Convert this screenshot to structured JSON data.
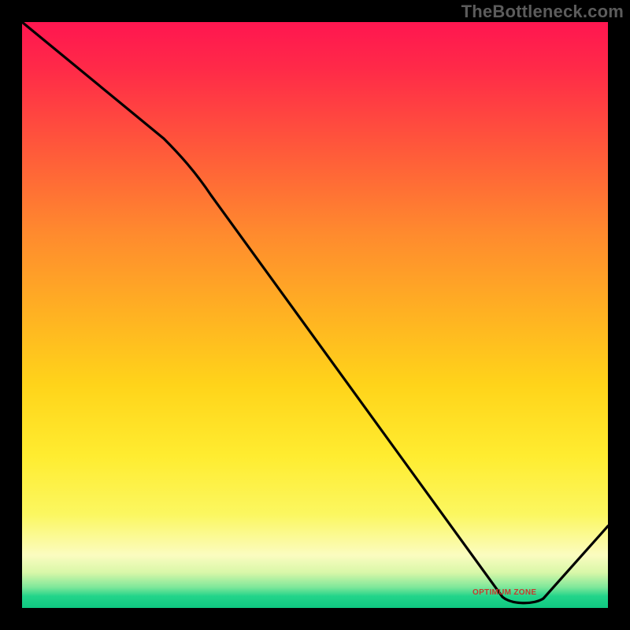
{
  "watermark": "TheBottleneck.com",
  "chart_data": {
    "type": "line",
    "title": "",
    "xlabel": "",
    "ylabel": "",
    "x": [
      0,
      24,
      82,
      88,
      100
    ],
    "values": [
      100,
      80,
      2,
      1,
      14
    ],
    "ylim": [
      0,
      100
    ],
    "xlim": [
      0,
      100
    ],
    "marker_label": "OPTIMUM ZONE",
    "marker_x_range": [
      79,
      90
    ],
    "marker_y": 1,
    "background_gradient": {
      "top": "#ff1a4d",
      "mid": "#ffd200",
      "bottom": "#16c87c"
    }
  },
  "colors": {
    "stroke": "#000000",
    "label": "#c63a2e",
    "watermark": "#5c5c5c"
  }
}
